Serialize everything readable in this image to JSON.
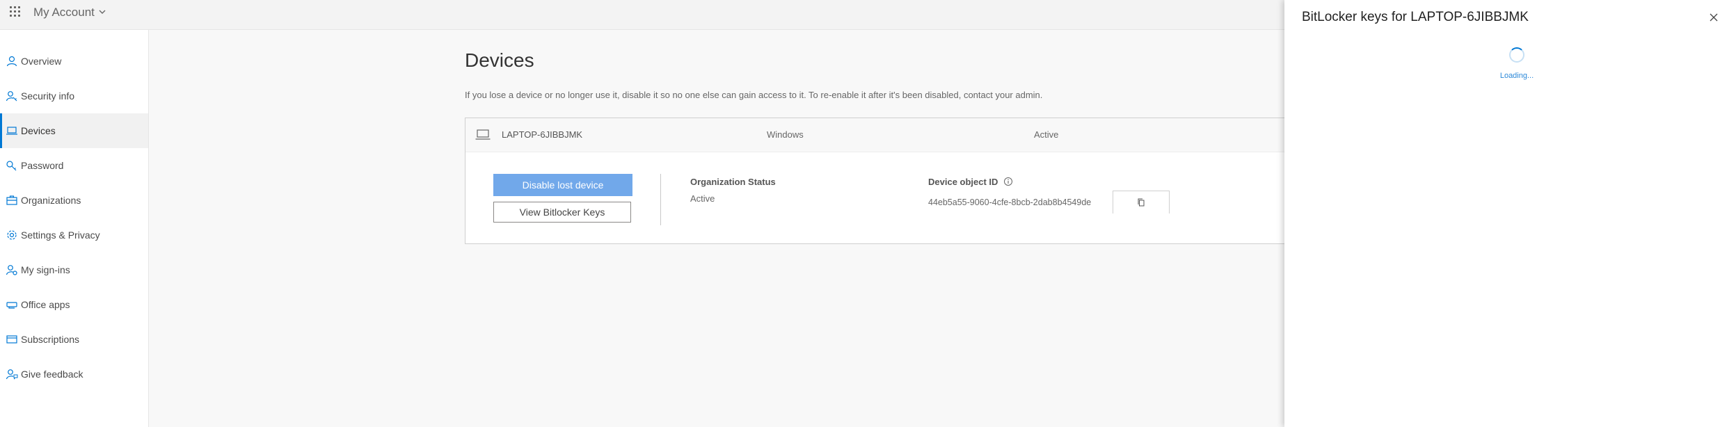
{
  "header": {
    "app_title": "My Account"
  },
  "sidebar": {
    "items": [
      {
        "label": "Overview",
        "icon": "person-icon"
      },
      {
        "label": "Security info",
        "icon": "security-info-icon"
      },
      {
        "label": "Devices",
        "icon": "laptop-icon",
        "selected": true
      },
      {
        "label": "Password",
        "icon": "key-icon"
      },
      {
        "label": "Organizations",
        "icon": "briefcase-icon"
      },
      {
        "label": "Settings & Privacy",
        "icon": "gear-icon"
      },
      {
        "label": "My sign-ins",
        "icon": "sign-ins-icon"
      },
      {
        "label": "Office apps",
        "icon": "apps-icon"
      },
      {
        "label": "Subscriptions",
        "icon": "subscriptions-icon"
      },
      {
        "label": "Give feedback",
        "icon": "feedback-icon"
      }
    ]
  },
  "main": {
    "title": "Devices",
    "description": "If you lose a device or no longer use it, disable it so no one else can gain access to it. To re-enable it after it's been disabled, contact your admin.",
    "device": {
      "name": "LAPTOP-6JIBBJMK",
      "os": "Windows",
      "state": "Active",
      "disable_button": "Disable lost device",
      "bitlocker_button": "View Bitlocker Keys",
      "org_status_label": "Organization Status",
      "org_status_value": "Active",
      "object_id_label": "Device object ID",
      "object_id_value": "44eb5a55-9060-4cfe-8bcb-2dab8b4549de"
    }
  },
  "panel": {
    "title": "BitLocker keys for LAPTOP-6JIBBJMK",
    "loading_text": "Loading..."
  },
  "colors": {
    "accent": "#0078d4",
    "primary_button": "#71a8ea"
  }
}
